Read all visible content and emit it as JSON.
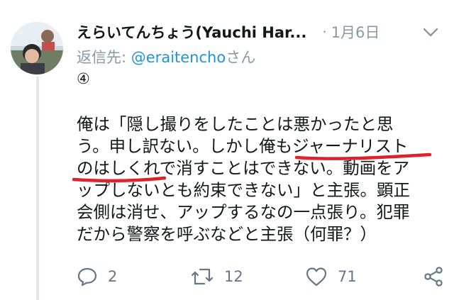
{
  "tweet": {
    "author_name": "えらいてんちょう(Yauchi Har...",
    "separator": "·",
    "date": "1月6日",
    "reply_prefix": "返信先: ",
    "reply_handle": "@eraitencho",
    "reply_suffix": "さん",
    "number_marker": "④",
    "body_lines": [
      "俺は「隠し撮りをしたことは悪かったと思",
      "う。申し訳ない。しかし俺もジャーナリスト",
      "のはしくれで消すことはできない。動画をア",
      "ップしないとも約束できない」と主張。顕正",
      "会側は消せ、アップするなの一点張り。犯罪",
      "だから警察を呼ぶなどと主張（何罪？）"
    ],
    "underline_color": "#e0202a"
  },
  "actions": {
    "reply_count": "2",
    "retweet_count": "12",
    "like_count": "71"
  },
  "icons": {
    "avatar": "avatar-photo",
    "menu": "chevron-down-icon",
    "reply": "reply-icon",
    "retweet": "retweet-icon",
    "like": "heart-icon",
    "share": "share-icon"
  }
}
